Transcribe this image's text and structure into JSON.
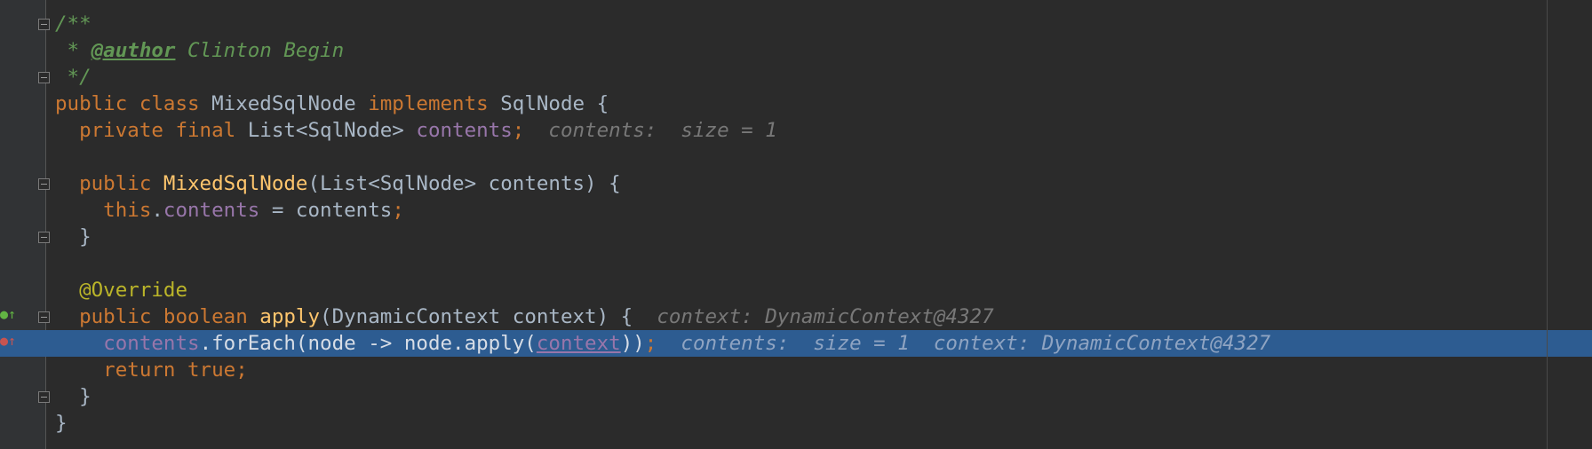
{
  "editor": {
    "lines": [
      {
        "segments": [
          {
            "t": "/**",
            "c": "doc"
          }
        ]
      },
      {
        "segments": [
          {
            "t": " * ",
            "c": "doc"
          },
          {
            "t": "@author",
            "c": "doctag"
          },
          {
            "t": " Clinton Begin",
            "c": "doc"
          }
        ]
      },
      {
        "segments": [
          {
            "t": " */",
            "c": "doc"
          }
        ]
      },
      {
        "segments": [
          {
            "t": "public class ",
            "c": "kw"
          },
          {
            "t": "MixedSqlNode ",
            "c": "plain"
          },
          {
            "t": "implements ",
            "c": "kw"
          },
          {
            "t": "SqlNode {",
            "c": "plain"
          }
        ]
      },
      {
        "segments": [
          {
            "t": "  private final ",
            "c": "kw"
          },
          {
            "t": "List<SqlNode> ",
            "c": "plain"
          },
          {
            "t": "contents",
            "c": "field"
          },
          {
            "t": ";",
            "c": "kw"
          },
          {
            "t": "  contents:  size = 1",
            "c": "hint"
          }
        ]
      },
      {
        "segments": []
      },
      {
        "segments": [
          {
            "t": "  public ",
            "c": "kw"
          },
          {
            "t": "MixedSqlNode",
            "c": "fn"
          },
          {
            "t": "(List<SqlNode> contents) {",
            "c": "plain"
          }
        ]
      },
      {
        "segments": [
          {
            "t": "    this",
            "c": "kw"
          },
          {
            "t": ".",
            "c": "plain"
          },
          {
            "t": "contents",
            "c": "field"
          },
          {
            "t": " = contents",
            "c": "plain"
          },
          {
            "t": ";",
            "c": "kw"
          }
        ]
      },
      {
        "segments": [
          {
            "t": "  }",
            "c": "plain"
          }
        ]
      },
      {
        "segments": []
      },
      {
        "segments": [
          {
            "t": "  @Override",
            "c": "ann"
          }
        ]
      },
      {
        "segments": [
          {
            "t": "  public boolean ",
            "c": "kw"
          },
          {
            "t": "apply",
            "c": "fn"
          },
          {
            "t": "(DynamicContext context) {",
            "c": "plain"
          },
          {
            "t": "  context: DynamicContext@4327",
            "c": "hint"
          }
        ]
      },
      {
        "segments": [
          {
            "t": "    ",
            "c": "plain"
          },
          {
            "t": "contents",
            "c": "field"
          },
          {
            "t": ".forEach(node -> node.apply(",
            "c": "plain"
          },
          {
            "t": "context",
            "c": "field ul"
          },
          {
            "t": "))",
            "c": "plain"
          },
          {
            "t": ";",
            "c": "kw"
          },
          {
            "t": "  contents:  size = 1  context: DynamicContext@4327",
            "c": "hint"
          }
        ]
      },
      {
        "segments": [
          {
            "t": "    return true",
            "c": "kw"
          },
          {
            "t": ";",
            "c": "kw"
          }
        ]
      },
      {
        "segments": [
          {
            "t": "  }",
            "c": "plain"
          }
        ]
      },
      {
        "segments": [
          {
            "t": "}",
            "c": "plain"
          }
        ]
      }
    ],
    "current_line": 12,
    "fold_lines": [
      0,
      2,
      6,
      8,
      11,
      14
    ]
  },
  "gutter": {
    "icons": [
      {
        "line": 11,
        "name": "implementing-method-icon",
        "glyph": "●↑",
        "color": "#62b543"
      },
      {
        "line": 12,
        "name": "breakpoint-icon",
        "glyph": "●↑",
        "color": "#c75450"
      }
    ]
  },
  "colors": {
    "background": "#2b2b2b",
    "gutter": "#313335",
    "current_line": "#2d5c91",
    "keyword": "#cc7832",
    "doc_comment": "#629755",
    "field": "#9876aa",
    "method": "#ffc66d",
    "annotation": "#bbb529",
    "hint": "#787878"
  }
}
